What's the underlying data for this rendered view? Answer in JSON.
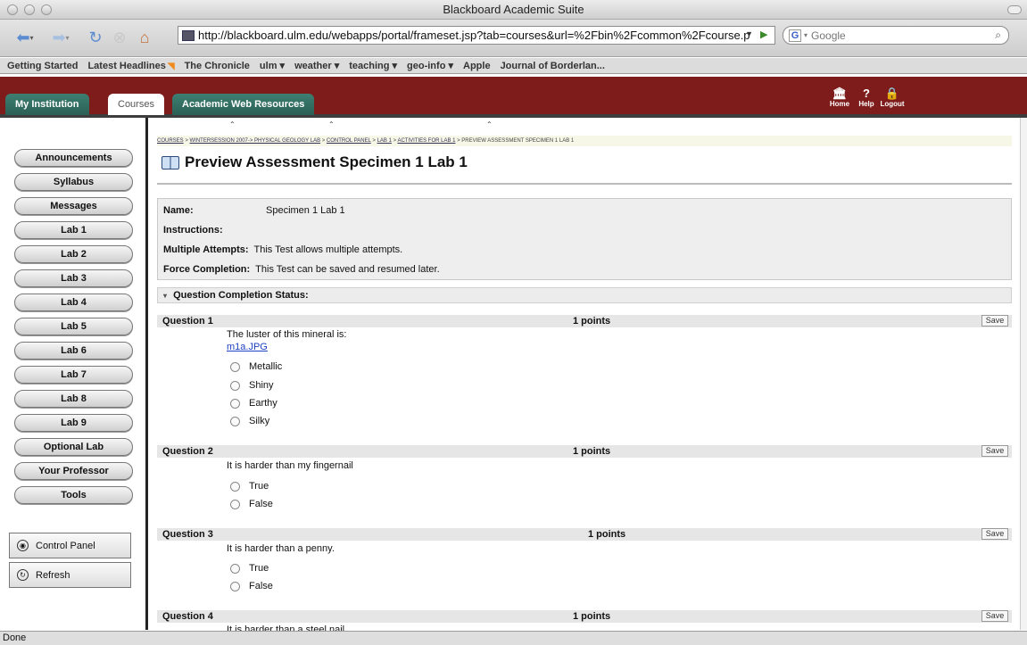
{
  "window": {
    "title": "Blackboard Academic Suite"
  },
  "toolbar": {
    "url": "http://blackboard.ulm.edu/webapps/portal/frameset.jsp?tab=courses&url=%2Fbin%2Fcommon%2Fcourse.p",
    "search_placeholder": "Google"
  },
  "bookmarks": [
    "Getting Started",
    "Latest Headlines",
    "The Chronicle",
    "ulm ▾",
    "weather ▾",
    "teaching ▾",
    "geo-info ▾",
    "Apple",
    "Journal of Borderlan..."
  ],
  "header": {
    "tabs": [
      "My Institution",
      "Courses",
      "Academic Web Resources"
    ],
    "tools": [
      {
        "icon": "home-icon",
        "label": "Home"
      },
      {
        "icon": "help-icon",
        "label": "Help"
      },
      {
        "icon": "lock-icon",
        "label": "Logout"
      }
    ]
  },
  "sidebar": {
    "items": [
      "Announcements",
      "Syllabus",
      "Messages",
      "Lab 1",
      "Lab 2",
      "Lab 3",
      "Lab 4",
      "Lab 5",
      "Lab 6",
      "Lab 7",
      "Lab 8",
      "Lab 9",
      "Optional Lab",
      "Your Professor",
      "Tools"
    ],
    "control_panel": "Control Panel",
    "refresh": "Refresh"
  },
  "breadcrumb": [
    "COURSES",
    "WINTERSESSION 2007-> PHYSICAL GEOLOGY LAB",
    "CONTROL PANEL",
    "LAB 1",
    "ACTIVITIES FOR LAB 1",
    "PREVIEW ASSESSMENT SPECIMEN 1 LAB 1"
  ],
  "page": {
    "title": "Preview Assessment Specimen 1 Lab 1"
  },
  "info": {
    "name_label": "Name:",
    "name_value": "Specimen 1 Lab 1",
    "instructions_label": "Instructions:",
    "attempts_label": "Multiple Attempts:",
    "attempts_value": "This Test allows multiple attempts.",
    "completion_label": "Force Completion:",
    "completion_value": "This Test can be saved and resumed later."
  },
  "status_section": {
    "label": "Question Completion Status:"
  },
  "questions": [
    {
      "number": "Question 1",
      "points": "1 points",
      "text": "The luster of this mineral is:",
      "link": "m1a.JPG",
      "options": [
        "Metallic",
        "Shiny",
        "Earthy",
        "Silky"
      ]
    },
    {
      "number": "Question 2",
      "points": "1 points",
      "text": "It is harder than my fingernail",
      "options": [
        "True",
        "False"
      ]
    },
    {
      "number": "Question 3",
      "points": "1 points",
      "text": "It is harder than a penny.",
      "options": [
        "True",
        "False"
      ]
    },
    {
      "number": "Question 4",
      "points": "1 points",
      "text": "It is harder than a steel nail."
    }
  ],
  "save_label": "Save",
  "statusbar": {
    "text": "Done"
  }
}
